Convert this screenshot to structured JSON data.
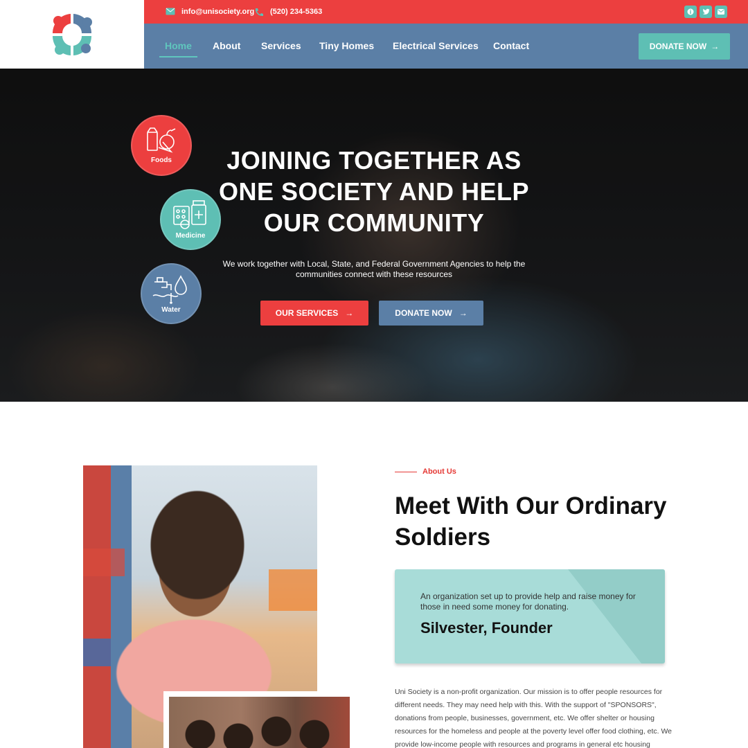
{
  "header": {
    "email": "info@unisociety.org",
    "phone": "(520) 234-5363",
    "social_icons": [
      "info-icon",
      "twitter-icon",
      "mail-icon"
    ],
    "nav": [
      {
        "label": "Home",
        "active": true
      },
      {
        "label": "About",
        "active": false
      },
      {
        "label": "Services",
        "active": false
      },
      {
        "label": "Tiny Homes",
        "active": false
      },
      {
        "label": "Electrical Services",
        "active": false
      },
      {
        "label": "Contact",
        "active": false
      }
    ],
    "donate_label": "DONATE NOW"
  },
  "hero": {
    "badges": [
      {
        "label": "Foods",
        "icon": "food-icon",
        "color": "#ec3f3f"
      },
      {
        "label": "Medicine",
        "icon": "medicine-icon",
        "color": "#5ebfb4"
      },
      {
        "label": "Water",
        "icon": "water-icon",
        "color": "#5b7fa6"
      }
    ],
    "title": "JOINING TOGETHER AS ONE SOCIETY AND HELP OUR COMMUNITY",
    "subtitle": "We work together with Local, State, and Federal Government Agencies to help the communities connect with these resources",
    "services_button": "OUR SERVICES",
    "donate_button": "DONATE NOW"
  },
  "about": {
    "label": "About Us",
    "title": "Meet With Our Ordinary Soldiers",
    "quote": "An organization set up to provide help and raise money for those in need some money for donating.",
    "founder": "Silvester, Founder",
    "body": "Uni Society is a non-profit organization. Our mission is to offer people resources for different needs. They may need help with this. With the support of \"SPONSORS\", donations from people, businesses, government, etc. We offer shelter or housing resources for the homeless and people at the poverty level offer food clothing, etc. We provide low-income people with resources and programs in general etc housing"
  },
  "colors": {
    "red": "#ec3f3f",
    "teal": "#5ebfb4",
    "blue": "#5b7fa6",
    "quote_bg": "#a8dcd8"
  }
}
